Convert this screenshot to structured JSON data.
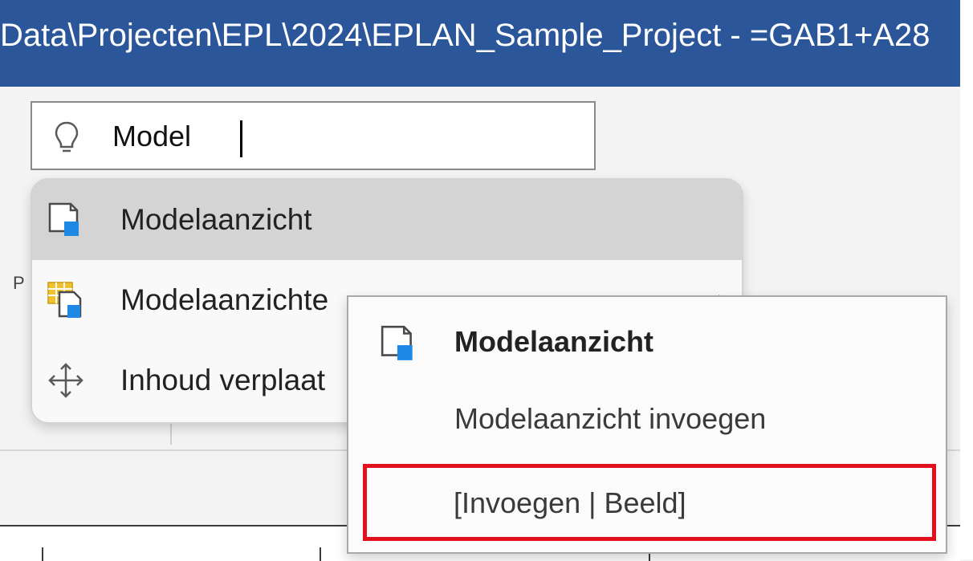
{
  "window": {
    "title": "Data\\Projecten\\EPL\\2024\\EPLAN_Sample_Project - =GAB1+A28"
  },
  "search": {
    "value": "Model",
    "icon": "lightbulb-icon"
  },
  "menu": {
    "items": [
      {
        "label": "Modelaanzicht",
        "icon": "model-view-icon",
        "highlighted": true
      },
      {
        "label": "Modelaanzichte",
        "icon": "model-views-table-icon",
        "has_submenu": true
      },
      {
        "label": "Inhoud verplaat",
        "icon": "move-arrows-icon"
      }
    ]
  },
  "submenu": {
    "title": "Modelaanzicht",
    "title_icon": "model-view-icon",
    "items": [
      {
        "label": "Modelaanzicht invoegen"
      }
    ],
    "hint": "[Invoegen | Beeld]",
    "hint_highlight_color": "#e3101e"
  },
  "colors": {
    "titlebar": "#2b579a",
    "accent_blue": "#1e88e5",
    "accent_yellow": "#f2c12e"
  }
}
